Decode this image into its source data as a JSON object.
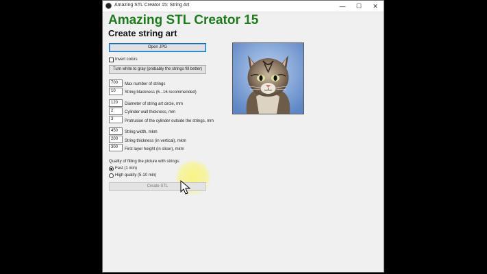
{
  "window": {
    "title": "Amazing STL Creator 15: String Art",
    "controls": {
      "minimize": "—",
      "maximize": "☐",
      "close": "✕"
    }
  },
  "header": {
    "app_title": "Amazing STL Creator 15",
    "subtitle": "Create string art"
  },
  "buttons": {
    "open_jpg": "Open JPG",
    "turn_white_gray": "Turn white to gray (probably the strings fill better)",
    "create_stl": "Create STL"
  },
  "options": {
    "invert_colors": {
      "label": "Invert colors",
      "checked": false
    }
  },
  "fields": [
    {
      "value": "700",
      "label": "Max number of strings"
    },
    {
      "value": "10",
      "label": "String blackness (6...16 recommended)"
    },
    {
      "value": "120",
      "label": "Diameter of string art circle, mm"
    },
    {
      "value": "2",
      "label": "Cylinder wall thickness, mm"
    },
    {
      "value": "3",
      "label": "Protrusion of the cylinder outside the strings, mm"
    },
    {
      "value": "450",
      "label": "String width, mkm"
    },
    {
      "value": "200",
      "label": "String thickness (in vertical), mkm"
    },
    {
      "value": "300",
      "label": "First layer height (in slicer), mkm"
    }
  ],
  "quality": {
    "label": "Quality of filling the picture with strings:",
    "options": [
      {
        "label": "Fast (1 min)",
        "selected": true
      },
      {
        "label": "High quality (5-10 min)",
        "selected": false
      }
    ]
  },
  "preview": {
    "subject": "tabby cat photo"
  },
  "icons": {
    "app": "app-icon",
    "cursor": "mouse-cursor-icon"
  },
  "colors": {
    "title_green": "#1b7c1b",
    "focus_blue": "#0078d7",
    "click_highlight": "#f7f27a"
  }
}
